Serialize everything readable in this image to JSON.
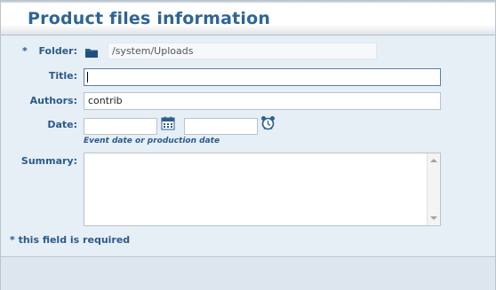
{
  "window": {
    "title": "Product files information"
  },
  "form": {
    "required_marker": "*",
    "folder": {
      "label": "Folder:",
      "value": "/system/Uploads",
      "icon": "folder-icon"
    },
    "title": {
      "label": "Title:",
      "value": ""
    },
    "authors": {
      "label": "Authors:",
      "value": "contrib"
    },
    "date": {
      "label": "Date:",
      "date_value": "",
      "time_value": "",
      "calendar_icon": "calendar-icon",
      "clock_icon": "alarm-clock-icon",
      "hint": "Event date or production date"
    },
    "summary": {
      "label": "Summary:",
      "value": ""
    },
    "required_note": "* this field is required"
  },
  "colors": {
    "title": "#2f6596",
    "label": "#2b5b88",
    "background": "#e6eef6"
  }
}
